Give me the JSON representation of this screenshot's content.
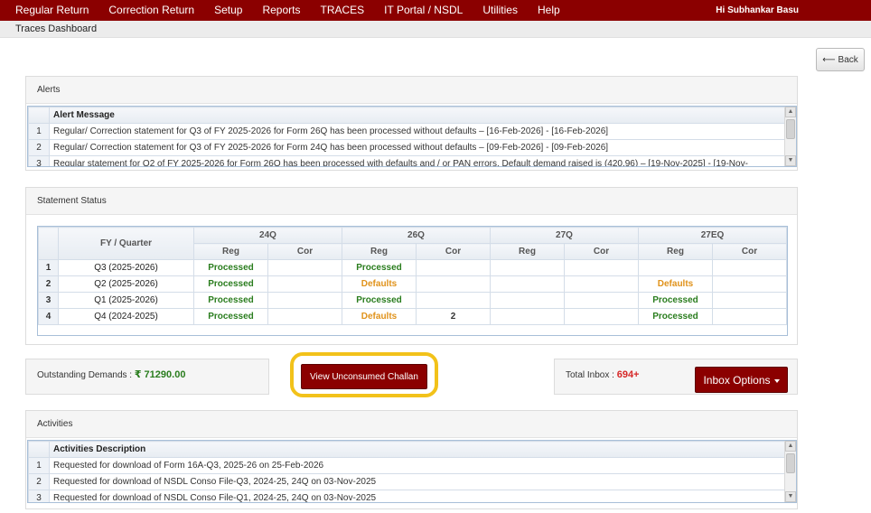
{
  "menu": {
    "items": [
      "Regular Return",
      "Correction Return",
      "Setup",
      "Reports",
      "TRACES",
      "IT Portal / NSDL",
      "Utilities",
      "Help"
    ],
    "greeting": "Hi Subhankar Basu"
  },
  "breadcrumb": "Traces Dashboard",
  "back_button": {
    "arrow": "⟵",
    "label": "Back"
  },
  "alerts": {
    "title": "Alerts",
    "column_header": "Alert Message",
    "rows": [
      {
        "n": "1",
        "text": "Regular/ Correction statement for Q3 of FY 2025-2026 for Form 26Q has been processed without defaults – [16-Feb-2026] - [16-Feb-2026]"
      },
      {
        "n": "2",
        "text": "Regular/ Correction statement for Q3 of FY 2025-2026 for Form 24Q has been processed without defaults – [09-Feb-2026] - [09-Feb-2026]"
      },
      {
        "n": "3",
        "text": "Regular statement for Q2 of FY 2025-2026 for Form 26Q has been processed with defaults and / or PAN errors. Default demand raised is (420.96) – [19-Nov-2025] - [19-Nov-"
      }
    ]
  },
  "statement_status": {
    "title": "Statement Status",
    "fy_header": "FY / Quarter",
    "forms": [
      "24Q",
      "26Q",
      "27Q",
      "27EQ"
    ],
    "sub_headers": {
      "reg": "Reg",
      "cor": "Cor"
    },
    "rows": [
      {
        "n": "1",
        "fy": "Q3 (2025-2026)",
        "cells": [
          "Processed",
          "",
          "Processed",
          "",
          "",
          "",
          "",
          ""
        ]
      },
      {
        "n": "2",
        "fy": "Q2 (2025-2026)",
        "cells": [
          "Processed",
          "",
          "Defaults",
          "",
          "",
          "",
          "Defaults",
          ""
        ]
      },
      {
        "n": "3",
        "fy": "Q1 (2025-2026)",
        "cells": [
          "Processed",
          "",
          "Processed",
          "",
          "",
          "",
          "Processed",
          ""
        ]
      },
      {
        "n": "4",
        "fy": "Q4 (2024-2025)",
        "cells": [
          "Processed",
          "",
          "Defaults",
          "2",
          "",
          "",
          "Processed",
          ""
        ]
      }
    ]
  },
  "demands": {
    "label": "Outstanding Demands :",
    "amount": "₹ 71290.00"
  },
  "challan_button": "View Unconsumed Challan",
  "inbox": {
    "label": "Total Inbox :",
    "count": "694+",
    "button": "Inbox Options"
  },
  "activities": {
    "title": "Activities",
    "column_header": "Activities Description",
    "rows": [
      {
        "n": "1",
        "text": "Requested for download of Form 16A-Q3, 2025-26 on 25-Feb-2026"
      },
      {
        "n": "2",
        "text": "Requested for download of NSDL Conso File-Q3, 2024-25, 24Q on 03-Nov-2025"
      },
      {
        "n": "3",
        "text": "Requested for download of NSDL Conso File-Q1, 2024-25, 24Q on 03-Nov-2025"
      }
    ]
  },
  "colors": {
    "menu_bg": "#8b0000",
    "processed": "#2a7d1e",
    "defaults": "#e0921a",
    "inbox_count": "#d62828",
    "highlight": "#f2c21a"
  }
}
